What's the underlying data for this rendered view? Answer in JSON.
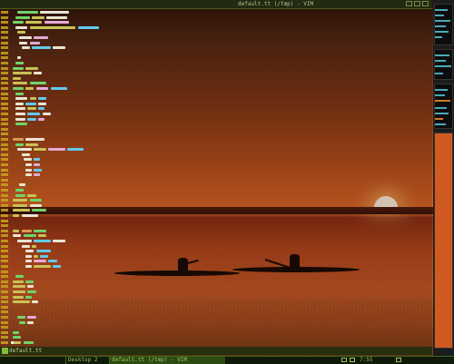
{
  "window": {
    "title": "default.tt (/tmp) - VIM",
    "buttons": [
      "minimize",
      "maximize",
      "close"
    ]
  },
  "editor": {
    "statusline_file": "default.tt",
    "cursor_mode_marker": "NORMAL"
  },
  "taskbar": {
    "workspace_label": "Desktop 2",
    "tasks": [
      {
        "label": "default.tt (/tmp) - VIM",
        "active": true
      }
    ],
    "clock": "7:55"
  },
  "tray": {
    "icons": [
      "network-icon",
      "volume-icon",
      "battery-icon"
    ]
  },
  "colors": {
    "keyword": "#c9c256",
    "tag": "#6fd36a",
    "string": "#e6a8d8",
    "text": "#e9e4d4",
    "variable": "#63c9ec",
    "comment": "#d89a54",
    "line_number": "#c8a420",
    "taskbar_text": "#9ec25a"
  }
}
